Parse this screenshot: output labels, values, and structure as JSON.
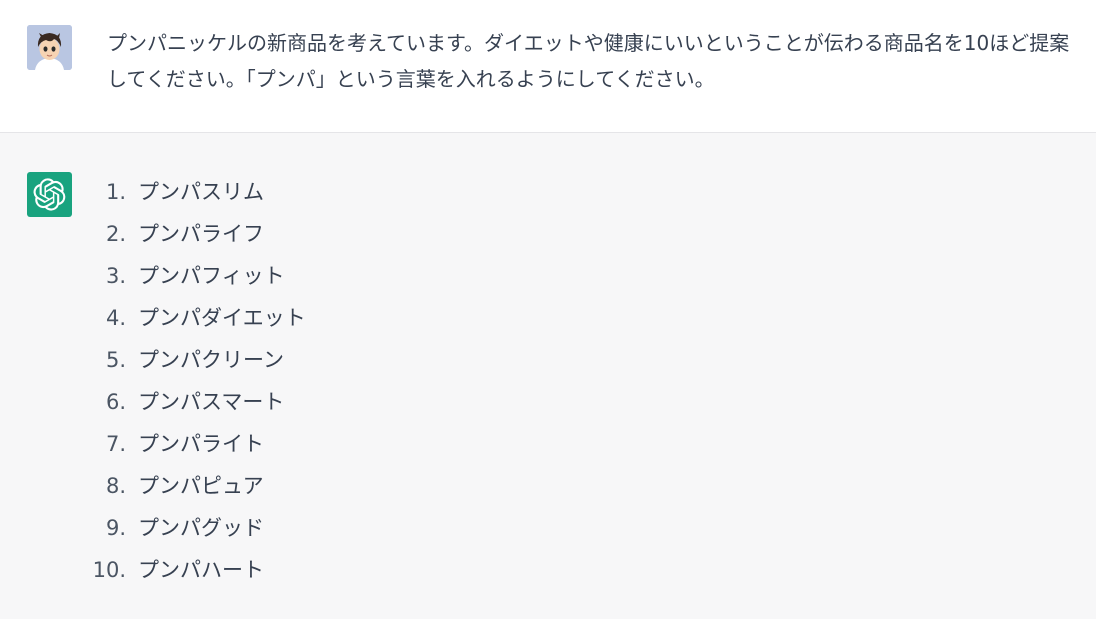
{
  "user_message": {
    "text": "プンパニッケルの新商品を考えています。ダイエットや健康にいいということが伝わる商品名を10ほど提案してください。「プンパ」という言葉を入れるようにしてください。"
  },
  "assistant_message": {
    "items": [
      {
        "number": "1.",
        "text": "プンパスリム"
      },
      {
        "number": "2.",
        "text": "プンパライフ"
      },
      {
        "number": "3.",
        "text": "プンパフィット"
      },
      {
        "number": "4.",
        "text": "プンパダイエット"
      },
      {
        "number": "5.",
        "text": "プンパクリーン"
      },
      {
        "number": "6.",
        "text": "プンパスマート"
      },
      {
        "number": "7.",
        "text": "プンパライト"
      },
      {
        "number": "8.",
        "text": "プンパピュア"
      },
      {
        "number": "9.",
        "text": "プンパグッド"
      },
      {
        "number": "10.",
        "text": "プンパハート"
      }
    ]
  },
  "colors": {
    "assistant_avatar": "#19a37f",
    "assistant_bg": "#f7f7f8",
    "user_bg": "#ffffff",
    "text": "#374151"
  },
  "icons": {
    "user_avatar": "cartoon-boy-avatar-icon",
    "assistant_avatar": "openai-logo-icon"
  }
}
